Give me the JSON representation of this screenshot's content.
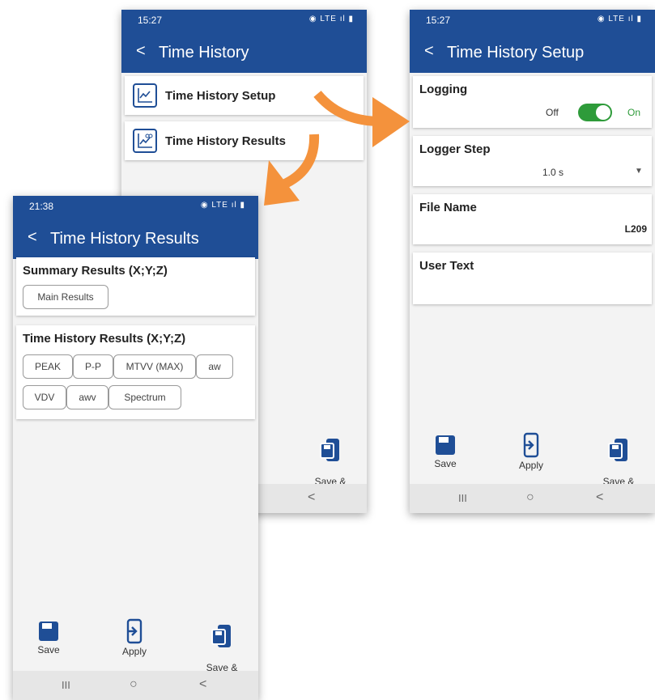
{
  "screen_a": {
    "time": "15:27",
    "status_icons": "◉ LTE ıl ▮",
    "back": "<",
    "title": "Time History",
    "menu": [
      {
        "label": "Time History Setup"
      },
      {
        "label": "Time History Results"
      }
    ],
    "actions": {
      "save_apply": "Save &\nApply"
    },
    "nav": {
      "recents": "III",
      "home": "○",
      "back": "<"
    }
  },
  "screen_b": {
    "time": "15:27",
    "status_icons": "◉ LTE ıl ▮",
    "back": "<",
    "title": "Time History Setup",
    "logging": {
      "label": "Logging",
      "off": "Off",
      "on": "On",
      "state": "on"
    },
    "logger_step": {
      "label": "Logger Step",
      "value": "1.0 s"
    },
    "file_name": {
      "label": "File Name",
      "value": "L209"
    },
    "user_text": {
      "label": "User Text"
    },
    "actions": {
      "save": "Save",
      "apply": "Apply",
      "save_apply": "Save &\nApply"
    },
    "nav": {
      "recents": "III",
      "home": "○",
      "back": "<"
    }
  },
  "screen_c": {
    "time": "21:38",
    "status_icons": "◉ LTE ıl ▮",
    "back": "<",
    "title": "Time History Results",
    "summary": {
      "title": "Summary Results (X;Y;Z)",
      "chips": [
        "Main Results"
      ]
    },
    "time_history": {
      "title": "Time History Results  (X;Y;Z)",
      "chips_row1": [
        "PEAK",
        "P-P",
        "MTVV (MAX)",
        "aw"
      ],
      "chips_row2": [
        "VDV",
        "awv",
        "Spectrum"
      ]
    },
    "actions": {
      "save": "Save",
      "apply": "Apply",
      "save_apply": "Save &\nApply"
    },
    "nav": {
      "recents": "III",
      "home": "○",
      "back": "<"
    }
  },
  "colors": {
    "primary": "#1f4e96",
    "accent_arrow": "#f4923c",
    "toggle_on": "#2e9b3a"
  }
}
